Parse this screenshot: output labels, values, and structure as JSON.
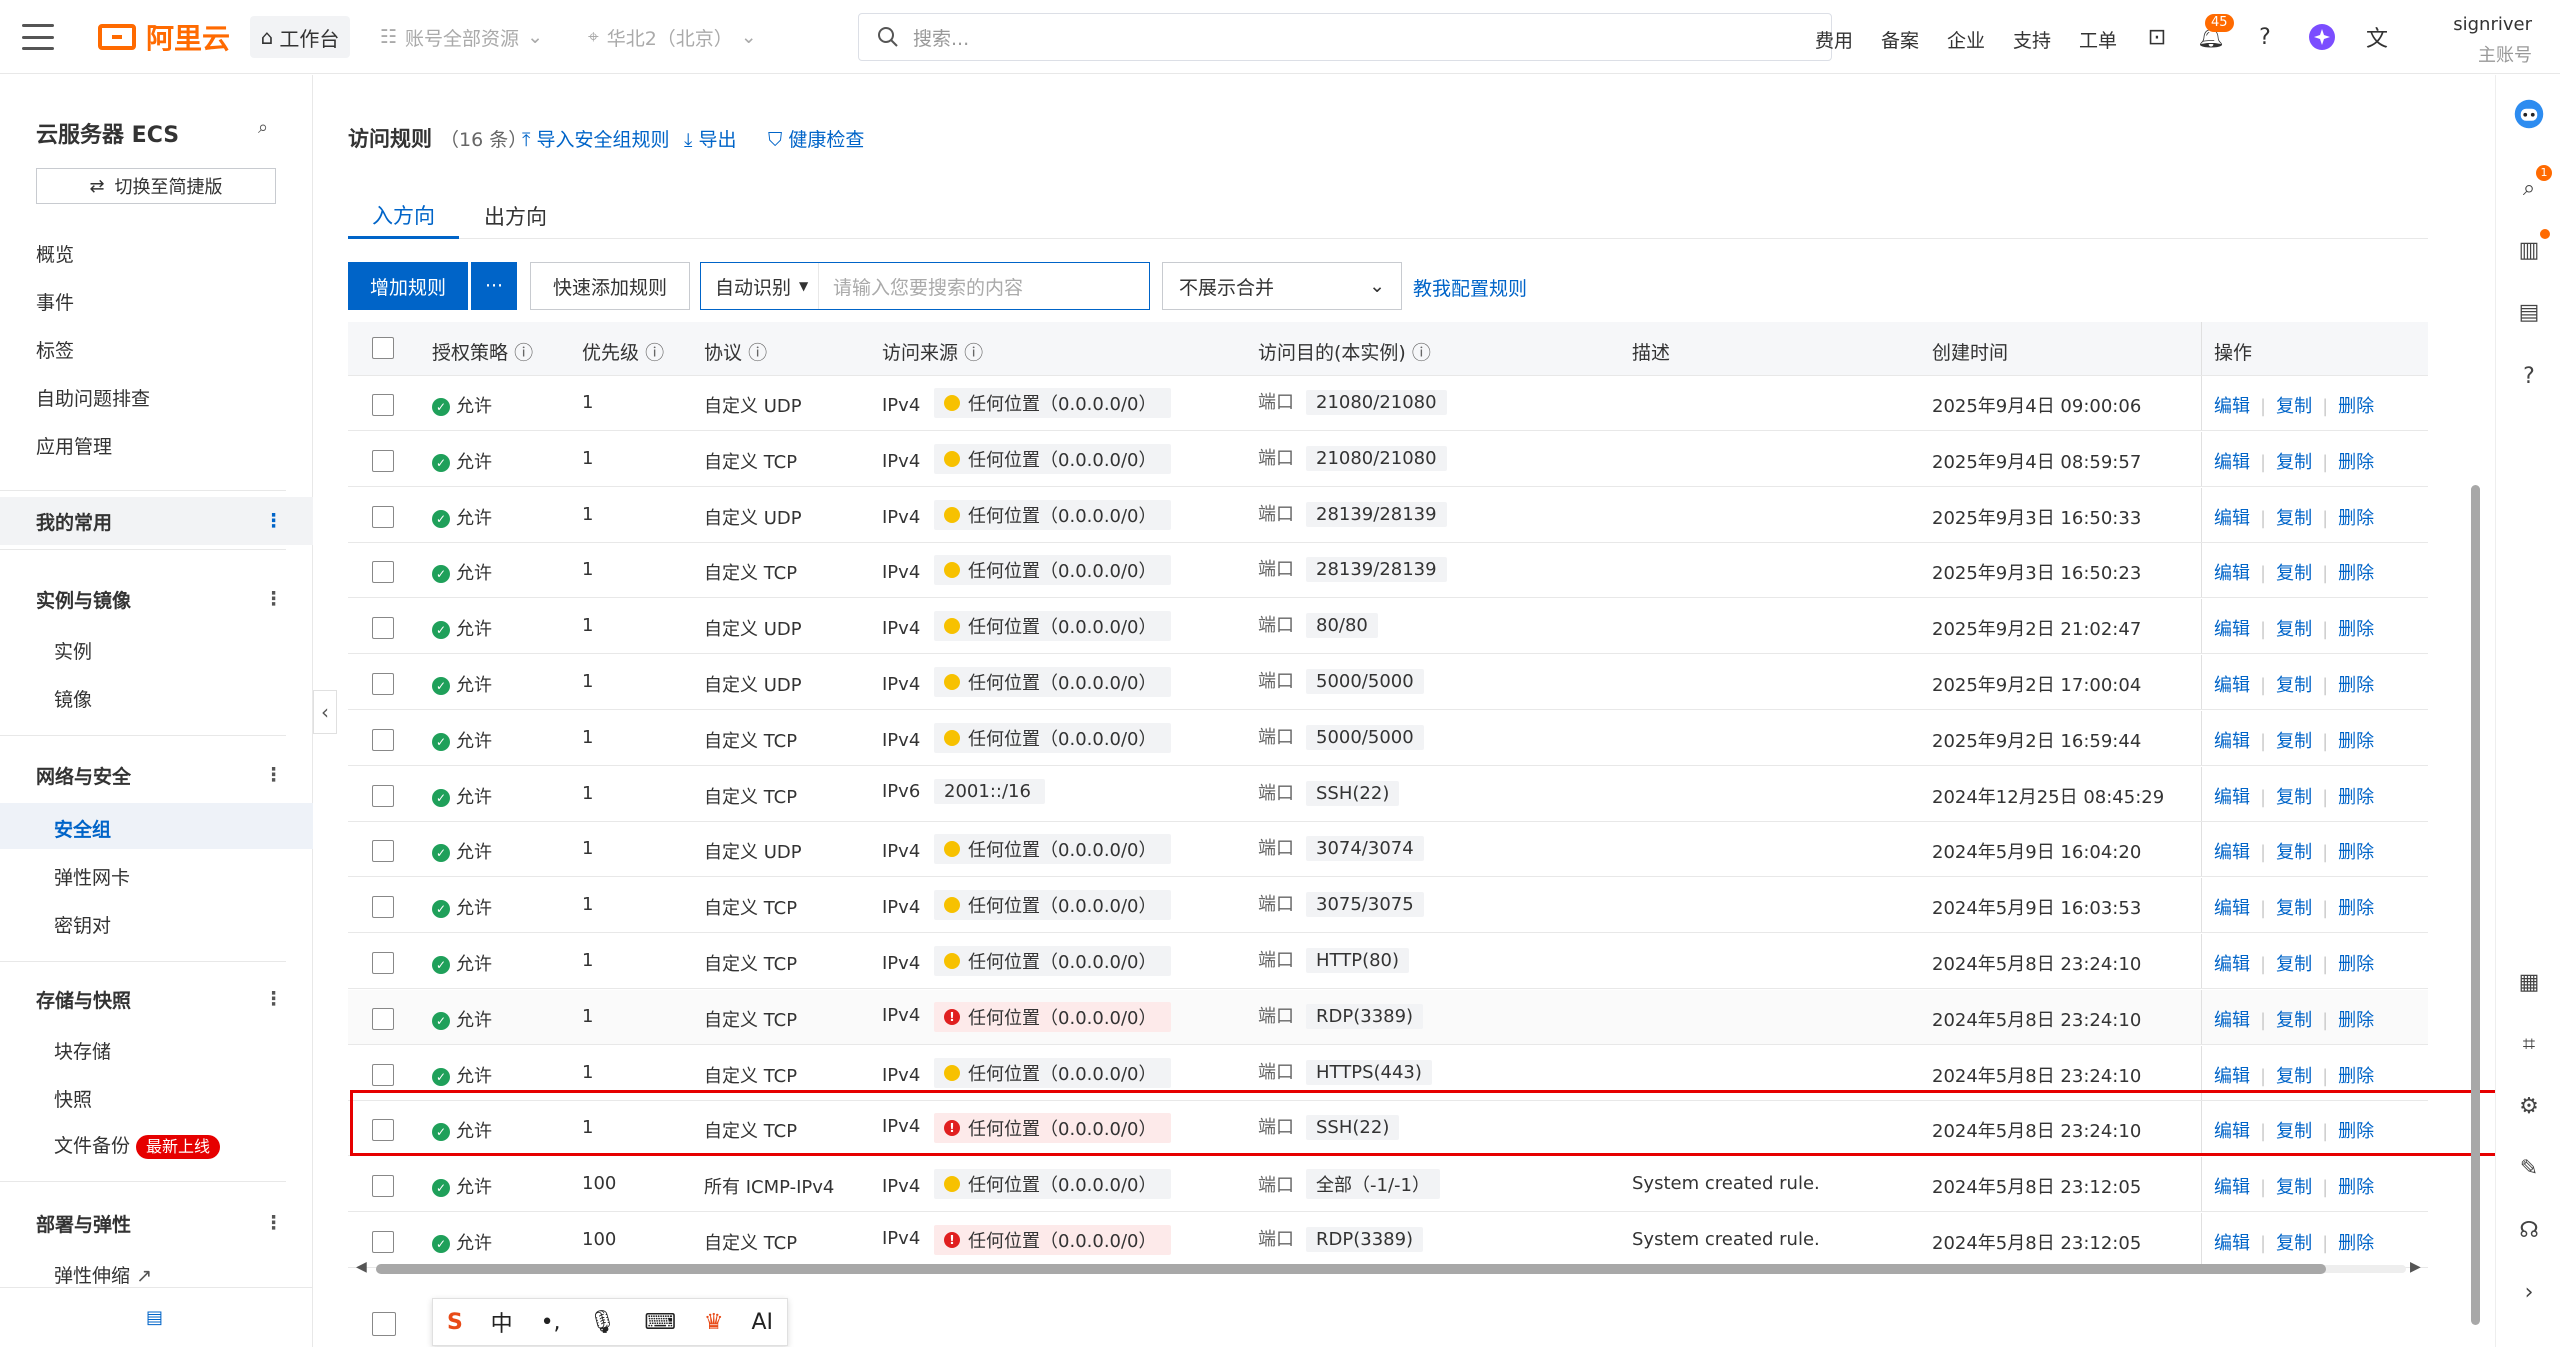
{
  "topbar": {
    "logo_text": "阿里云",
    "workspace": "工作台",
    "resource_scope": "账号全部资源",
    "region": "华北2（北京）",
    "search_placeholder": "搜索...",
    "nav": [
      "费用",
      "备案",
      "企业",
      "支持",
      "工单"
    ],
    "notification_count": "45",
    "username": "signriver",
    "role": "主账号"
  },
  "sidebar": {
    "title": "云服务器 ECS",
    "switch_label": "切换至简捷版",
    "top_items": [
      "概览",
      "事件",
      "标签",
      "自助问题排查",
      "应用管理"
    ],
    "favorites": "我的常用",
    "groups": [
      {
        "title": "实例与镜像",
        "items": [
          "实例",
          "镜像"
        ]
      },
      {
        "title": "网络与安全",
        "items": [
          "安全组",
          "弹性网卡",
          "密钥对"
        ]
      },
      {
        "title": "存储与快照",
        "items": [
          "块存储",
          "快照",
          "文件备份"
        ]
      },
      {
        "title": "部署与弹性",
        "items": [
          "弹性伸缩"
        ]
      }
    ],
    "new_tag": "最新上线"
  },
  "page": {
    "title": "访问规则",
    "count": "（16 条）",
    "import_link": "导入安全组规则",
    "export_link": "导出",
    "health_link": "健康检查",
    "tabs": [
      "入方向",
      "出方向"
    ],
    "add_rule": "增加规则",
    "more": "···",
    "quick_add": "快速添加规则",
    "auto_detect": "自动识别",
    "search_placeholder": "请输入您要搜索的内容",
    "merge_select": "不展示合并",
    "teach_link": "教我配置规则"
  },
  "table": {
    "headers": [
      "授权策略",
      "优先级",
      "协议",
      "访问来源",
      "访问目的(本实例)",
      "描述",
      "创建时间",
      "操作"
    ],
    "ops": [
      "编辑",
      "复制",
      "删除"
    ],
    "port_label": "端口",
    "rows": [
      {
        "policy": "允许",
        "priority": "1",
        "protocol": "自定义 UDP",
        "ipver": "IPv4",
        "source": "任何位置（0.0.0.0/0）",
        "level": "warn",
        "port": "21080/21080",
        "desc": "",
        "time": "2025年9月4日 09:00:06"
      },
      {
        "policy": "允许",
        "priority": "1",
        "protocol": "自定义 TCP",
        "ipver": "IPv4",
        "source": "任何位置（0.0.0.0/0）",
        "level": "warn",
        "port": "21080/21080",
        "desc": "",
        "time": "2025年9月4日 08:59:57"
      },
      {
        "policy": "允许",
        "priority": "1",
        "protocol": "自定义 UDP",
        "ipver": "IPv4",
        "source": "任何位置（0.0.0.0/0）",
        "level": "warn",
        "port": "28139/28139",
        "desc": "",
        "time": "2025年9月3日 16:50:33"
      },
      {
        "policy": "允许",
        "priority": "1",
        "protocol": "自定义 TCP",
        "ipver": "IPv4",
        "source": "任何位置（0.0.0.0/0）",
        "level": "warn",
        "port": "28139/28139",
        "desc": "",
        "time": "2025年9月3日 16:50:23"
      },
      {
        "policy": "允许",
        "priority": "1",
        "protocol": "自定义 UDP",
        "ipver": "IPv4",
        "source": "任何位置（0.0.0.0/0）",
        "level": "warn",
        "port": "80/80",
        "desc": "",
        "time": "2025年9月2日 21:02:47"
      },
      {
        "policy": "允许",
        "priority": "1",
        "protocol": "自定义 UDP",
        "ipver": "IPv4",
        "source": "任何位置（0.0.0.0/0）",
        "level": "warn",
        "port": "5000/5000",
        "desc": "",
        "time": "2025年9月2日 17:00:04"
      },
      {
        "policy": "允许",
        "priority": "1",
        "protocol": "自定义 TCP",
        "ipver": "IPv4",
        "source": "任何位置（0.0.0.0/0）",
        "level": "warn",
        "port": "5000/5000",
        "desc": "",
        "time": "2025年9月2日 16:59:44"
      },
      {
        "policy": "允许",
        "priority": "1",
        "protocol": "自定义 TCP",
        "ipver": "IPv6",
        "source": "2001::/16",
        "level": "none",
        "port": "SSH(22)",
        "desc": "",
        "time": "2024年12月25日 08:45:29"
      },
      {
        "policy": "允许",
        "priority": "1",
        "protocol": "自定义 UDP",
        "ipver": "IPv4",
        "source": "任何位置（0.0.0.0/0）",
        "level": "warn",
        "port": "3074/3074",
        "desc": "",
        "time": "2024年5月9日 16:04:20"
      },
      {
        "policy": "允许",
        "priority": "1",
        "protocol": "自定义 TCP",
        "ipver": "IPv4",
        "source": "任何位置（0.0.0.0/0）",
        "level": "warn",
        "port": "3075/3075",
        "desc": "",
        "time": "2024年5月9日 16:03:53"
      },
      {
        "policy": "允许",
        "priority": "1",
        "protocol": "自定义 TCP",
        "ipver": "IPv4",
        "source": "任何位置（0.0.0.0/0）",
        "level": "warn",
        "port": "HTTP(80)",
        "desc": "",
        "time": "2024年5月8日 23:24:10"
      },
      {
        "policy": "允许",
        "priority": "1",
        "protocol": "自定义 TCP",
        "ipver": "IPv4",
        "source": "任何位置（0.0.0.0/0）",
        "level": "danger",
        "port": "RDP(3389)",
        "desc": "",
        "time": "2024年5月8日 23:24:10"
      },
      {
        "policy": "允许",
        "priority": "1",
        "protocol": "自定义 TCP",
        "ipver": "IPv4",
        "source": "任何位置（0.0.0.0/0）",
        "level": "warn",
        "port": "HTTPS(443)",
        "desc": "",
        "time": "2024年5月8日 23:24:10"
      },
      {
        "policy": "允许",
        "priority": "1",
        "protocol": "自定义 TCP",
        "ipver": "IPv4",
        "source": "任何位置（0.0.0.0/0）",
        "level": "danger",
        "port": "SSH(22)",
        "desc": "",
        "time": "2024年5月8日 23:24:10"
      },
      {
        "policy": "允许",
        "priority": "100",
        "protocol": "所有 ICMP-IPv4",
        "ipver": "IPv4",
        "source": "任何位置（0.0.0.0/0）",
        "level": "warn",
        "port": "全部（-1/-1）",
        "desc": "System created rule.",
        "time": "2024年5月8日 23:12:05"
      },
      {
        "policy": "允许",
        "priority": "100",
        "protocol": "自定义 TCP",
        "ipver": "IPv4",
        "source": "任何位置（0.0.0.0/0）",
        "level": "danger",
        "port": "RDP(3389)",
        "desc": "System created rule.",
        "time": "2024年5月8日 23:12:05"
      }
    ]
  },
  "ime": [
    "中",
    "AI"
  ]
}
